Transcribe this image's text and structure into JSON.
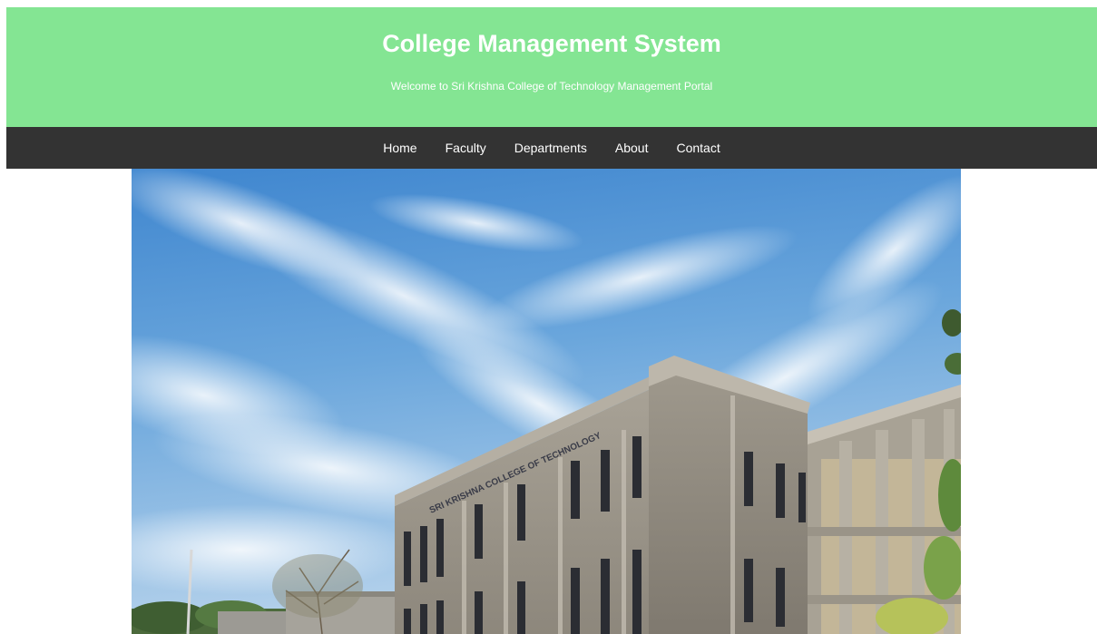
{
  "header": {
    "title": "College Management System",
    "subtitle": "Welcome to Sri Krishna College of Technology Management Portal",
    "background_color": "#84e593"
  },
  "nav": {
    "background_color": "#333333",
    "items": [
      {
        "label": "Home"
      },
      {
        "label": "Faculty"
      },
      {
        "label": "Departments"
      },
      {
        "label": "About"
      },
      {
        "label": "Contact"
      }
    ]
  },
  "hero": {
    "building_sign": "SRI KRISHNA COLLEGE OF TECHNOLOGY"
  }
}
